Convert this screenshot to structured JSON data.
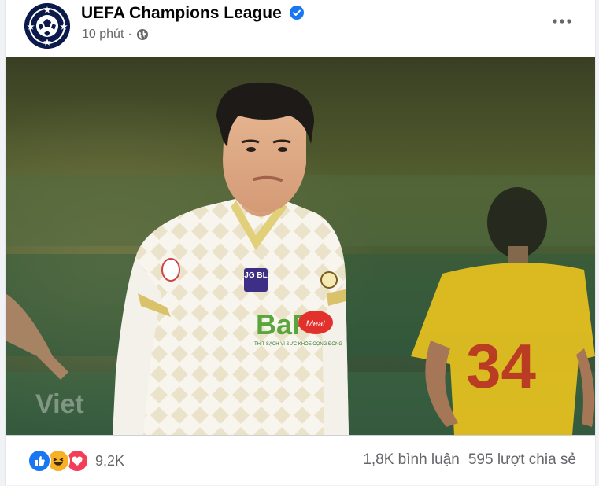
{
  "post": {
    "author": "UEFA Champions League",
    "time": "10 phút",
    "separator": "·",
    "privacy_icon": "globe-icon",
    "verified_icon": "verified-badge-icon",
    "more_icon": "more-options-icon"
  },
  "photo": {
    "watermark": "Viet",
    "shirt_sponsor_badge": "JG BL",
    "shirt_sponsor": "BaF",
    "shirt_sponsor_tag": "Meat",
    "shirt_slogan": "THỊT SẠCH VÌ SỨC KHỎE CỘNG ĐỒNG",
    "background_player_number": "34"
  },
  "engagement": {
    "reactions": [
      "like-reaction-icon",
      "haha-reaction-icon",
      "love-reaction-icon"
    ],
    "reaction_count": "9,2K",
    "comments": "1,8K bình luận",
    "shares": "595 lượt chia sẻ"
  },
  "colors": {
    "like": "#1877f2",
    "haha": "#f7b125",
    "love": "#f33e58",
    "verified": "#1877f2",
    "secondary_text": "#65676b"
  }
}
